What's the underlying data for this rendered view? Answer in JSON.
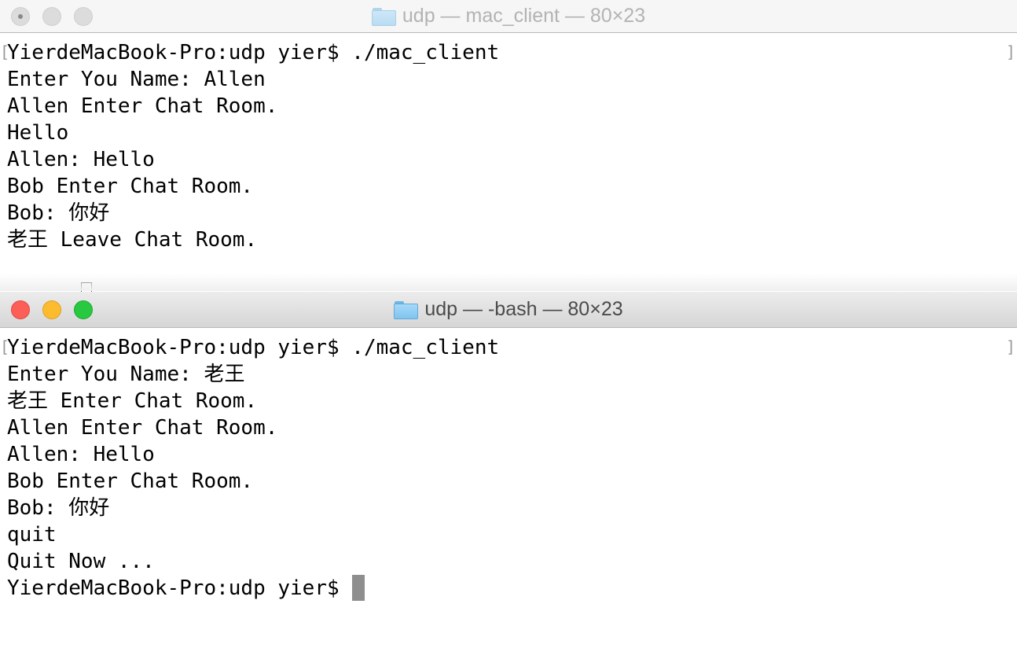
{
  "windows": [
    {
      "title": "udp — mac_client — 80×23",
      "icon": "folder-icon",
      "state": "inactive",
      "lines": [
        "YierdeMacBook-Pro:udp yier$ ./mac_client",
        "Enter You Name: Allen",
        "Allen Enter Chat Room.",
        "Hello",
        "Allen: Hello",
        "Bob Enter Chat Room.",
        "Bob: 你好",
        "老王 Leave Chat Room."
      ],
      "cursor": "hollow"
    },
    {
      "title": "udp — -bash — 80×23",
      "icon": "folder-icon",
      "state": "active",
      "lines": [
        "YierdeMacBook-Pro:udp yier$ ./mac_client",
        "Enter You Name: 老王",
        "老王 Enter Chat Room.",
        "Allen Enter Chat Room.",
        "Allen: Hello",
        "Bob Enter Chat Room.",
        "Bob: 你好",
        "quit",
        "Quit Now ..."
      ],
      "prompt": "YierdeMacBook-Pro:udp yier$",
      "cursor": "solid"
    }
  ],
  "colors": {
    "close": "#fc5f57",
    "minimize": "#fdbc2e",
    "maximize": "#28c840",
    "cursor": "#8e8e8e"
  }
}
